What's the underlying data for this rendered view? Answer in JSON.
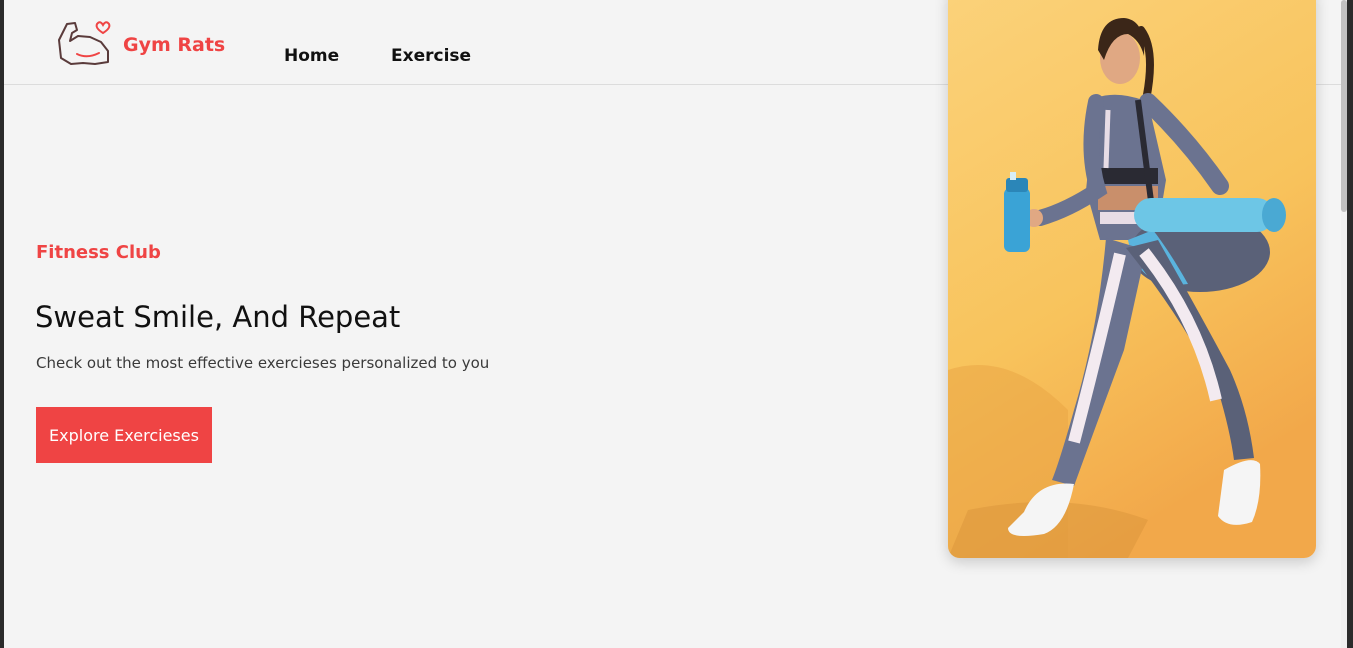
{
  "brand": {
    "name": "Gym Rats",
    "accent": "#ef4444"
  },
  "nav": {
    "home": "Home",
    "exercise": "Exercise"
  },
  "hero": {
    "subtitle": "Fitness Club",
    "title": "Sweat Smile, And Repeat",
    "description": "Check out the most effective exercieses personalized to you",
    "button": "Explore Exercieses",
    "image_subject": "woman-walking-with-gym-bag-and-shaker"
  }
}
